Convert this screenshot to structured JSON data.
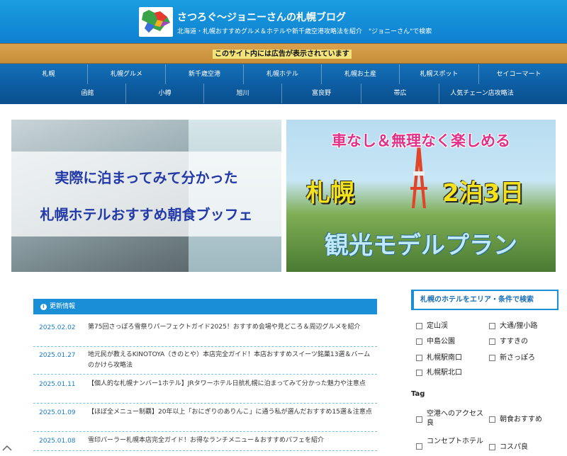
{
  "header": {
    "title": "さつろぐ〜ジョニーさんの札幌ブログ",
    "description": "北海道・札幌おすすめグルメ＆ホテルや新千歳空港攻略法を紹介　\"ジョニーさん\"で検索",
    "logo_icon": "hokkaido-map-icon"
  },
  "ad_notice": "このサイト内には広告が表示されています",
  "nav": {
    "row1": [
      "札幌",
      "札幌グルメ",
      "新千歳空港",
      "札幌ホテル",
      "札幌お土産",
      "札幌スポット",
      "セイコーマート"
    ],
    "row2": [
      "函館",
      "小樽",
      "旭川",
      "富良野",
      "帯広",
      "人気チェーン店攻略法"
    ]
  },
  "hero": {
    "left_line1": "実際に泊まってみて分かった",
    "left_line2": "札幌ホテルおすすめ朝食ブッフェ",
    "right_top": "車なし＆無理なく楽しめる",
    "right_mid_left": "札幌",
    "right_mid_right": "2泊3日",
    "right_bottom": "観光モデルプラン"
  },
  "updates": {
    "heading": "更新情報",
    "items": [
      {
        "date": "2025.02.02",
        "text": "第75回さっぽろ雪祭りパーフェクトガイド2025！おすすめ会場や見どころ＆周辺グルメを紹介"
      },
      {
        "date": "2025.01.27",
        "text": "地元民が教えるKINOTOYA（きのとや）本店完全ガイド！本店おすすめスイーツ銘菓13選＆バームのかけら攻略法"
      },
      {
        "date": "2025.01.11",
        "text": "【個人的な札幌ナンバー1ホテル】JRタワーホテル日航札幌に泊まってみて分かった魅力や注意点"
      },
      {
        "date": "2025.01.09",
        "text": "【ほぼ全メニュー制覇】20年以上「おにぎりのありんこ」に通う私が選んだおすすめ15選＆注意点"
      },
      {
        "date": "2025.01.08",
        "text": "雪印パーラー札幌本店完全ガイド！お得なランチメニュー＆おすすめパフェを紹介"
      }
    ]
  },
  "sidebar": {
    "search_title": "札幌のホテルをエリア・条件で検索",
    "areas": [
      "定山渓",
      "大通/狸小路",
      "中島公園",
      "すすきの",
      "札幌駅南口",
      "新さっぽろ",
      "札幌駅北口"
    ],
    "tag_title": "Tag",
    "tags": [
      "空港へのアクセス良",
      "朝食おすすめ",
      "コンセプトホテル",
      "コスパ良"
    ]
  },
  "colors": {
    "header_blue": "#1a9ee0",
    "nav_blue": "#0d5ea3",
    "ad_gold": "#d9a14e",
    "link_blue": "#1a7ac8"
  }
}
